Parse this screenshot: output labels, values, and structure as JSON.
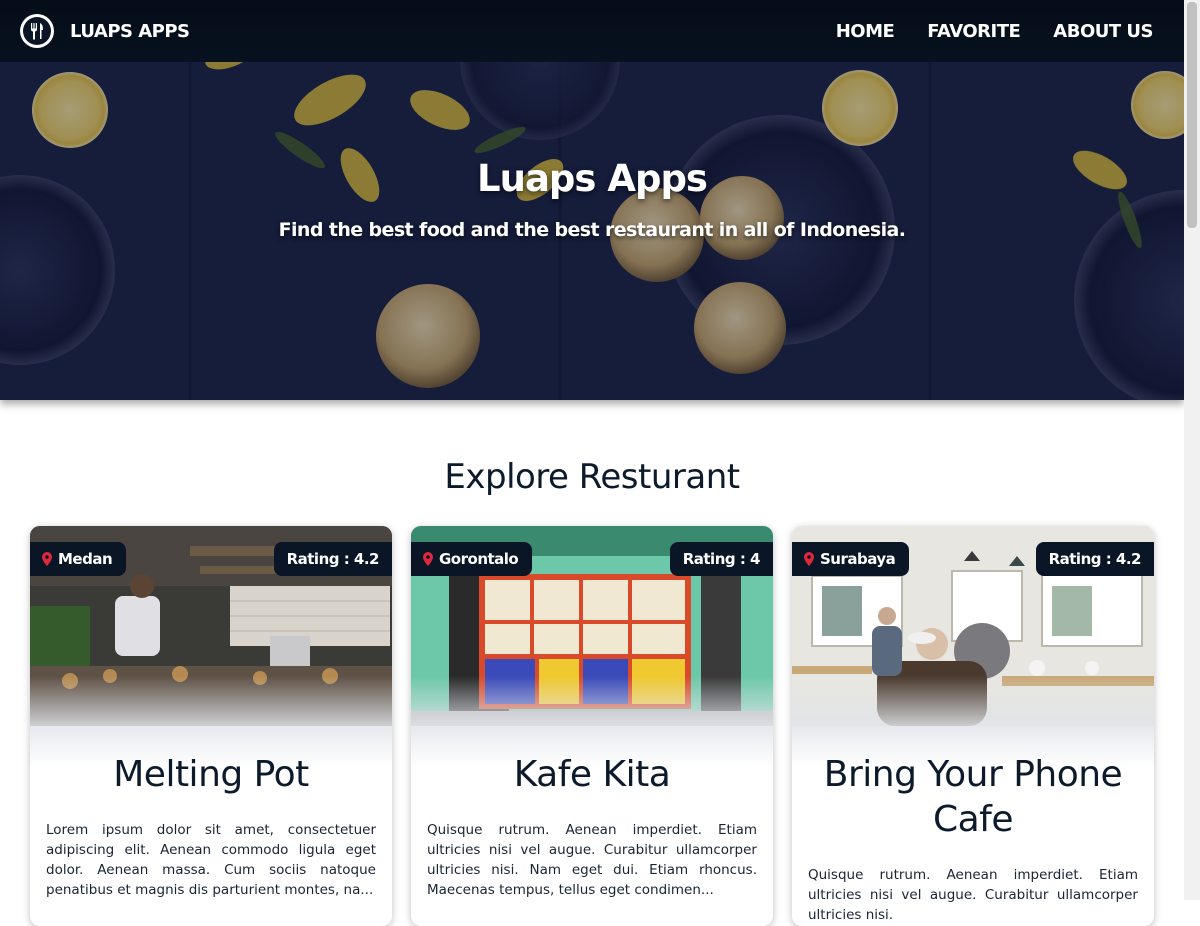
{
  "navbar": {
    "brand": "LUAPS APPS",
    "logo_icon": "fork-knife-icon",
    "links": [
      "HOME",
      "FAVORITE",
      "ABOUT US"
    ]
  },
  "hero": {
    "title": "Luaps Apps",
    "subtitle": "Find the best food and the best restaurant in all of Indonesia."
  },
  "section": {
    "title": "Explore Resturant"
  },
  "restaurants": [
    {
      "city": "Medan",
      "rating": "Rating : 4.2",
      "name": "Melting Pot",
      "description": "Lorem ipsum dolor sit amet, consectetuer adipiscing elit. Aenean commodo ligula eget dolor. Aenean massa. Cum sociis natoque penatibus et magnis dis parturient montes, na..."
    },
    {
      "city": "Gorontalo",
      "rating": "Rating : 4",
      "name": "Kafe Kita",
      "description": "Quisque rutrum. Aenean imperdiet. Etiam ultricies nisi vel augue. Curabitur ullamcorper ultricies nisi. Nam eget dui. Etiam rhoncus. Maecenas tempus, tellus eget condimen..."
    },
    {
      "city": "Surabaya",
      "rating": "Rating : 4.2",
      "name": "Bring Your Phone Cafe",
      "description": "Quisque rutrum. Aenean imperdiet. Etiam ultricies nisi vel augue. Curabitur ullamcorper ultricies nisi."
    }
  ],
  "colors": {
    "navbar": "#06101c",
    "badge": "#0a1626",
    "text_dark": "#0c1a2b",
    "pin": "#e0283c"
  }
}
